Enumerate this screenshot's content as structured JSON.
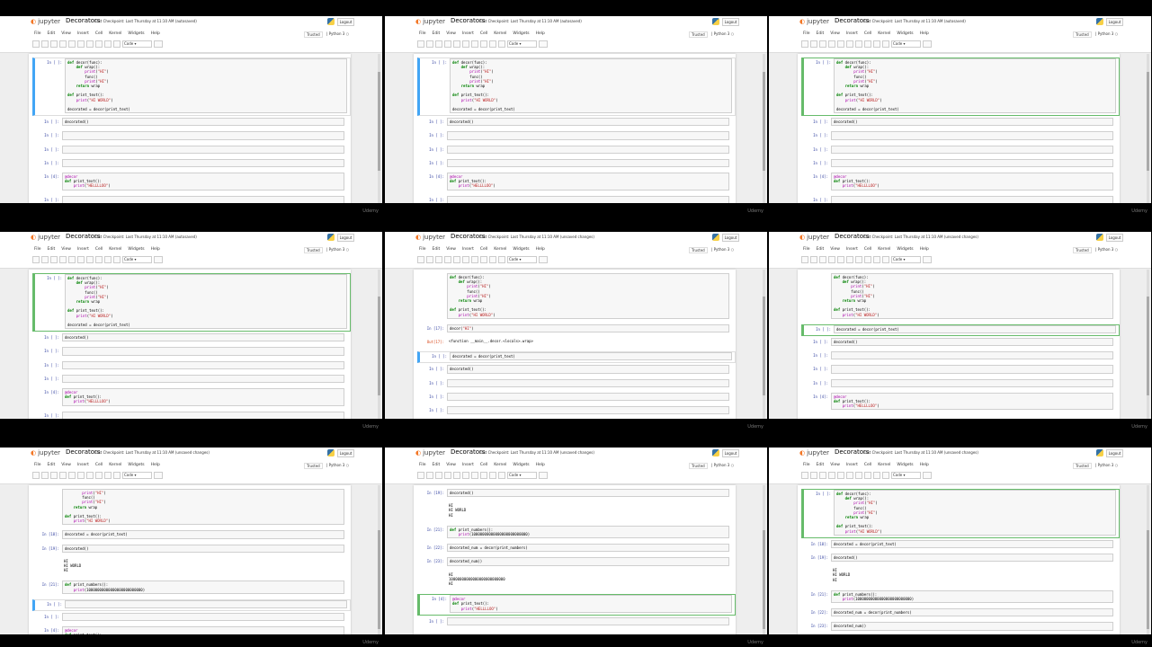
{
  "app": {
    "logo": "jupyter",
    "menu": [
      "File",
      "Edit",
      "View",
      "Insert",
      "Cell",
      "Kernel",
      "Widgets",
      "Help"
    ],
    "trusted": "Trusted",
    "kernel": "Python 3",
    "logout": "Logout",
    "cell_type": "Code",
    "watermark": "Udemy"
  },
  "tiles": [
    {
      "title": "Decorators",
      "checkpoint": "Last Checkpoint: Last Thursday at 11:10 AM (autosaved)",
      "cells": [
        {
          "prompt": "In [ ]:",
          "code": "def decor(func):\n    def wrap():\n        print(\"HI\")\n        func()\n        print(\"HI\")\n    return wrap\n\ndef print_text():\n    print(\"HI WORLD\")\n\ndecorated = decor(print_text)"
        },
        {
          "prompt": "In [ ]:",
          "code": "decorated()"
        },
        {
          "prompt": "In [ ]:",
          "code": ""
        },
        {
          "prompt": "In [ ]:",
          "code": ""
        },
        {
          "prompt": "In [ ]:",
          "code": ""
        },
        {
          "prompt": "In [4]:",
          "code": "@decor\ndef print_text():\n    print(\"HELLLLOO\")"
        },
        {
          "prompt": "In [ ]:",
          "code": ""
        }
      ]
    },
    {
      "title": "Decorators",
      "checkpoint": "Last Checkpoint: Last Thursday at 11:10 AM (autosaved)",
      "cells": [
        {
          "prompt": "In [ ]:",
          "code": "def decor(func):\n    def wrap():\n        print(\"HI\")\n        func()\n        print(\"HI\")\n    return wrap\n\ndef print_text():\n    print(\"HI WORLD\")\n\ndecorated = decor(print_text)"
        },
        {
          "prompt": "In [ ]:",
          "code": "decorated()"
        },
        {
          "prompt": "In [ ]:",
          "code": ""
        },
        {
          "prompt": "In [ ]:",
          "code": ""
        },
        {
          "prompt": "In [ ]:",
          "code": ""
        },
        {
          "prompt": "In [4]:",
          "code": "@decor\ndef print_text():\n    print(\"HELLLLOO\")"
        },
        {
          "prompt": "In [ ]:",
          "code": ""
        }
      ]
    },
    {
      "title": "Decorators",
      "checkpoint": "Last Checkpoint: Last Thursday at 11:10 AM (autosaved)",
      "cells": [
        {
          "prompt": "In [ ]:",
          "code": "def decor(func):\n    def wrap():\n        print(\"HI\")\n        func()\n        print(\"HI\")\n    return wrap\n\ndef print_text():\n    print(\"HI WORLD\")\n\ndecorated = decor(print_text)"
        },
        {
          "prompt": "In [ ]:",
          "code": "decorated()"
        },
        {
          "prompt": "In [ ]:",
          "code": ""
        },
        {
          "prompt": "In [ ]:",
          "code": ""
        },
        {
          "prompt": "In [ ]:",
          "code": ""
        },
        {
          "prompt": "In [4]:",
          "code": "@decor\ndef print_text():\n    print(\"HELLLLOO\")"
        },
        {
          "prompt": "In [ ]:",
          "code": ""
        }
      ]
    },
    {
      "title": "Decorators",
      "checkpoint": "Last Checkpoint: Last Thursday at 11:10 AM (autosaved)",
      "cells": [
        {
          "prompt": "In [ ]:",
          "code": "def decor(func):\n    def wrap():\n        print(\"HI\")\n        func()\n        print(\"HI\")\n    return wrap\n\ndef print_text():\n    print(\"HI WORLD\")\n\ndecorated = decor(print_text)"
        },
        {
          "prompt": "In [ ]:",
          "code": "decorated()"
        },
        {
          "prompt": "In [ ]:",
          "code": ""
        },
        {
          "prompt": "In [ ]:",
          "code": ""
        },
        {
          "prompt": "In [ ]:",
          "code": ""
        },
        {
          "prompt": "In [4]:",
          "code": "@decor\ndef print_text():\n    print(\"HELLLLOO\")"
        },
        {
          "prompt": "In [ ]:",
          "code": ""
        }
      ]
    },
    {
      "title": "Decorators",
      "checkpoint": "Last Checkpoint: Last Thursday at 11:10 AM (unsaved changes)",
      "cells": [
        {
          "prompt": "",
          "code": "def decor(func):\n    def wrap():\n        print(\"HI\")\n        func()\n        print(\"HI\")\n    return wrap\n\ndef print_text():\n    print(\"HI WORLD\")"
        },
        {
          "prompt": "In [17]:",
          "code": "decor(\"HI\")"
        },
        {
          "prompt": "Out[17]:",
          "code": "<function __main__.decor.<locals>.wrap>",
          "out": true
        },
        {
          "prompt": "In [ ]:",
          "code": "decorated = decor(print_text)"
        },
        {
          "prompt": "In [ ]:",
          "code": "decorated()"
        },
        {
          "prompt": "In [ ]:",
          "code": ""
        },
        {
          "prompt": "In [ ]:",
          "code": ""
        },
        {
          "prompt": "In [ ]:",
          "code": ""
        }
      ]
    },
    {
      "title": "Decorators",
      "checkpoint": "Last Checkpoint: Last Thursday at 11:10 AM (unsaved changes)",
      "cells": [
        {
          "prompt": "",
          "code": "def decor(func):\n    def wrap():\n        print(\"HI\")\n        func()\n        print(\"HI\")\n    return wrap\n\ndef print_text():\n    print(\"HI WORLD\")"
        },
        {
          "prompt": "In [ ]:",
          "code": "decorated = decor(print_text)"
        },
        {
          "prompt": "In [ ]:",
          "code": "decorated()"
        },
        {
          "prompt": "In [ ]:",
          "code": ""
        },
        {
          "prompt": "In [ ]:",
          "code": ""
        },
        {
          "prompt": "In [ ]:",
          "code": ""
        },
        {
          "prompt": "In [4]:",
          "code": "@decor\ndef print_text():\n    print(\"HELLLLOO\")"
        }
      ]
    },
    {
      "title": "Decorators",
      "checkpoint": "Last Checkpoint: Last Thursday at 11:10 AM (unsaved changes)",
      "cells": [
        {
          "prompt": "",
          "code": "        print(\"HI\")\n        func()\n        print(\"HI\")\n    return wrap\n\ndef print_text():\n    print(\"HI WORLD\")"
        },
        {
          "prompt": "In [18]:",
          "code": "decorated = decor(print_text)"
        },
        {
          "prompt": "In [19]:",
          "code": "decorated()"
        },
        {
          "prompt": "",
          "code": "HI\nHI WORLD\nHI",
          "out": true
        },
        {
          "prompt": "In [21]:",
          "code": "def print_numbers():\n    print(10000000000000000000000000)"
        },
        {
          "prompt": "In [ ]:",
          "code": ""
        },
        {
          "prompt": "In [ ]:",
          "code": ""
        },
        {
          "prompt": "In [4]:",
          "code": "@decor\ndef print_text():\n    print(\"HELLLLOO\")"
        }
      ]
    },
    {
      "title": "Decorators",
      "checkpoint": "Last Checkpoint: Last Thursday at 11:10 AM (unsaved changes)",
      "cells": [
        {
          "prompt": "In [19]:",
          "code": "decorated()"
        },
        {
          "prompt": "",
          "code": "HI\nHI WORLD\nHI",
          "out": true
        },
        {
          "prompt": "In [21]:",
          "code": "def print_numbers():\n    print(10000000000000000000000000)"
        },
        {
          "prompt": "In [22]:",
          "code": "decorated_num = decor(print_numbers)"
        },
        {
          "prompt": "In [23]:",
          "code": "decorated_num()"
        },
        {
          "prompt": "",
          "code": "HI\n10000000000000000000000000\nHI",
          "out": true
        },
        {
          "prompt": "In [4]:",
          "code": "@decor\ndef print_text():\n    print(\"HELLLLOO\")"
        },
        {
          "prompt": "In [ ]:",
          "code": ""
        }
      ]
    },
    {
      "title": "Decorators",
      "checkpoint": "Last Checkpoint: Last Thursday at 11:10 AM (unsaved changes)",
      "cells": [
        {
          "prompt": "In [ ]:",
          "code": "def decor(func):\n    def wrap():\n        print(\"HI\")\n        func()\n        print(\"HI\")\n    return wrap\n\ndef print_text():\n    print(\"HI WORLD\")"
        },
        {
          "prompt": "In [18]:",
          "code": "decorated = decor(print_text)"
        },
        {
          "prompt": "In [19]:",
          "code": "decorated()"
        },
        {
          "prompt": "",
          "code": "HI\nHI WORLD\nHI",
          "out": true
        },
        {
          "prompt": "In [21]:",
          "code": "def print_numbers():\n    print(10000000000000000000000000)"
        },
        {
          "prompt": "In [22]:",
          "code": "decorated_num = decor(print_numbers)"
        },
        {
          "prompt": "In [23]:",
          "code": "decorated_num()"
        }
      ]
    }
  ]
}
